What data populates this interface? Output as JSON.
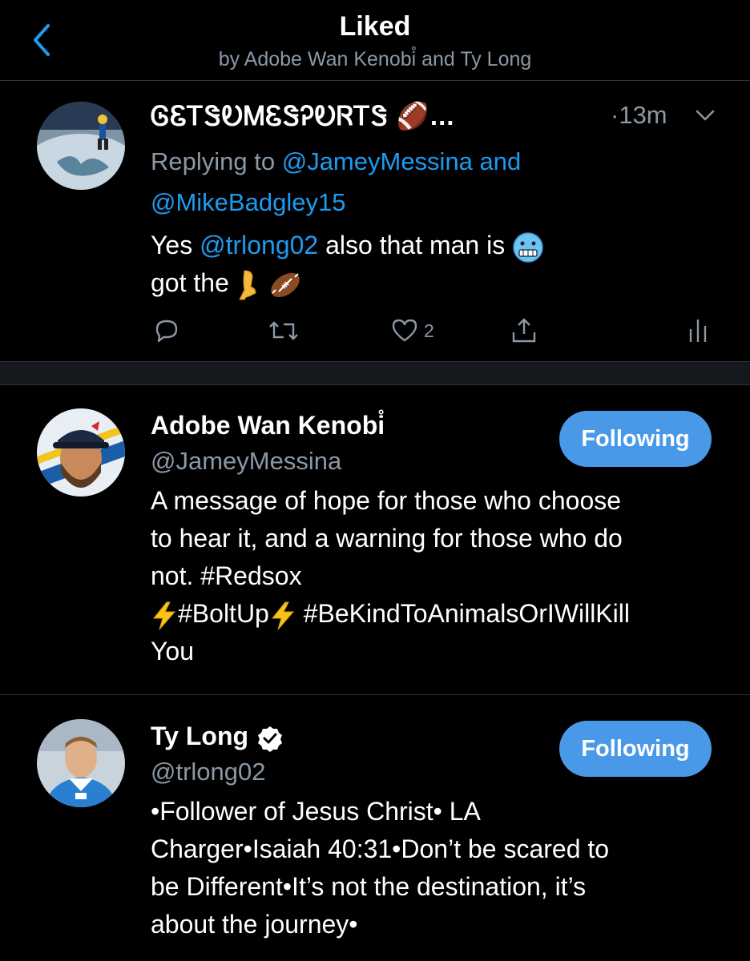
{
  "header": {
    "title": "Liked",
    "subtitle": "by Adobe Wan Kenobi̊ and Ty Long",
    "back_icon": "chevron-left-icon"
  },
  "tweet": {
    "display_name": "ᎶᏋᎢᏕᎧᎷᏋᏕᎮᎧᏒᎢᏕ 🏈...",
    "time": "·13m",
    "reply_prefix": "Replying to ",
    "reply_handle_1": "@JameyMessina",
    "reply_and": " and",
    "reply_handle_2": "@MikeBadgley15",
    "body_yes": "Yes ",
    "body_mention": "@trlong02",
    "body_rest": " also that man is",
    "body_line2": "got the",
    "emojis": [
      "cold-face-icon",
      "leg-icon",
      "football-icon"
    ],
    "like_count": "2"
  },
  "users": [
    {
      "name": "Adobe Wan Kenobi̊",
      "handle": "@JameyMessina",
      "button": "Following",
      "bio_line1": "A message of hope for those who choose",
      "bio_line2": "to hear it, and a warning for those who do",
      "bio_line3": "not. #Redsox",
      "bio_line4_a": "#BoltUp",
      "bio_line4_b": "#BeKindToAnimalsOrIWillKill",
      "bio_line5": "You"
    },
    {
      "name": "Ty Long",
      "handle": "@trlong02",
      "button": "Following",
      "bio_line1": "•Follower of Jesus Christ• LA",
      "bio_line2": "Charger•Isaiah 40:31•Don’t be scared to",
      "bio_line3": "be Different•It’s not the destination, it’s",
      "bio_line4": "about the journey•"
    }
  ],
  "colors": {
    "background": "#000000",
    "accent": "#1d9bf0",
    "button": "#4a99e9",
    "muted": "#8b98a5"
  }
}
